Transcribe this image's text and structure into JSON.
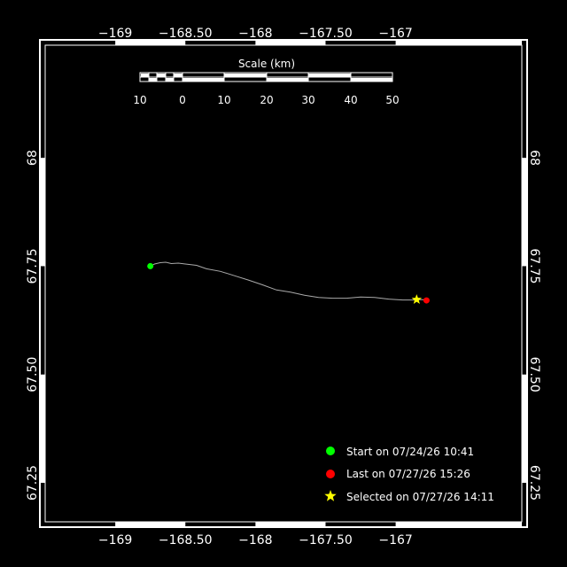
{
  "chart_data": {
    "type": "scatter",
    "xlim": [
      -169.5,
      -166.1
    ],
    "ylim": [
      67.16,
      68.26
    ],
    "x_ticks": [
      {
        "value": -169,
        "label": "−169"
      },
      {
        "value": -168.5,
        "label": "−168.50"
      },
      {
        "value": -168,
        "label": "−168"
      },
      {
        "value": -167.5,
        "label": "−167.50"
      },
      {
        "value": -167,
        "label": "−167"
      }
    ],
    "y_ticks": [
      {
        "value": 68,
        "label": "68"
      },
      {
        "value": 67.75,
        "label": "67.75"
      },
      {
        "value": 67.5,
        "label": "67.50"
      },
      {
        "value": 67.25,
        "label": "67.25"
      }
    ],
    "track": {
      "color": "#aaaaaa",
      "lon": [
        -168.75,
        -168.72,
        -168.68,
        -168.64,
        -168.6,
        -168.55,
        -168.5,
        -168.42,
        -168.35,
        -168.25,
        -168.15,
        -168.05,
        -167.95,
        -167.85,
        -167.75,
        -167.65,
        -167.55,
        -167.45,
        -167.35,
        -167.25,
        -167.15,
        -167.05,
        -166.95,
        -166.85,
        -166.82,
        -166.78
      ],
      "lat": [
        67.75,
        67.755,
        67.758,
        67.759,
        67.756,
        67.757,
        67.755,
        67.752,
        67.744,
        67.738,
        67.728,
        67.718,
        67.707,
        67.695,
        67.69,
        67.683,
        67.678,
        67.676,
        67.676,
        67.679,
        67.678,
        67.674,
        67.672,
        67.672,
        67.673,
        67.672
      ]
    },
    "markers": [
      {
        "name": "start",
        "lon": -168.75,
        "lat": 67.75,
        "color": "#00ff00",
        "shape": "circle"
      },
      {
        "name": "last",
        "lon": -166.78,
        "lat": 67.671,
        "color": "#ff0000",
        "shape": "circle"
      },
      {
        "name": "selected",
        "lon": -166.85,
        "lat": 67.673,
        "color": "#ffff00",
        "shape": "star"
      }
    ],
    "scale_bar": {
      "title": "Scale (km)",
      "labels": [
        "10",
        "0",
        "10",
        "20",
        "30",
        "40",
        "50"
      ]
    },
    "legend": {
      "position": "bottom-right",
      "items": [
        {
          "label": "Start on 07/24/26 10:41",
          "color": "#00ff00",
          "shape": "circle"
        },
        {
          "label": "Last on 07/27/26 15:26",
          "color": "#ff0000",
          "shape": "circle"
        },
        {
          "label": "Selected on 07/27/26 14:11",
          "color": "#ffff00",
          "shape": "star"
        }
      ]
    }
  }
}
